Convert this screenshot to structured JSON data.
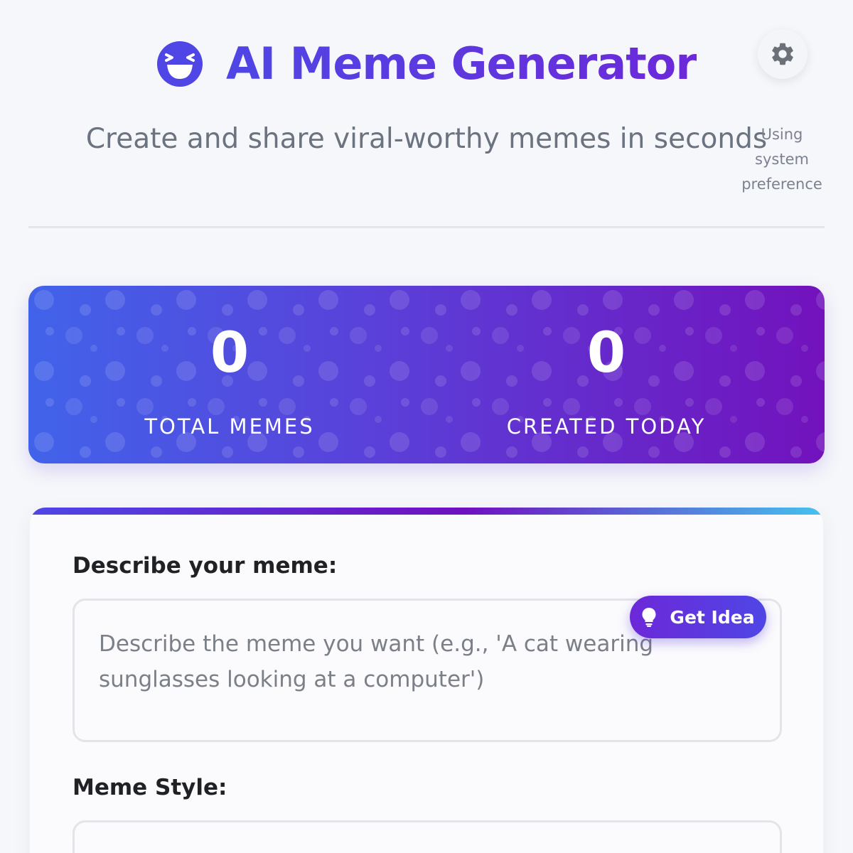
{
  "header": {
    "title": "AI Meme Generator",
    "subtitle": "Create and share viral-worthy memes in seconds",
    "logo_icon": "laughing-face-icon",
    "settings_icon": "gear-icon",
    "theme_note": "Using system preference"
  },
  "stats": {
    "total_memes": {
      "value": "0",
      "label": "TOTAL MEMES"
    },
    "created_today": {
      "value": "0",
      "label": "CREATED TODAY"
    }
  },
  "form": {
    "describe_label": "Describe your meme:",
    "describe_placeholder": "Describe the meme you want (e.g., 'A cat wearing sunglasses looking at a computer')",
    "get_idea_label": "Get Idea",
    "get_idea_icon": "lightbulb-icon",
    "style_label": "Meme Style:",
    "style_value": ""
  },
  "colors": {
    "accent": "#4f46e5",
    "accent_purple": "#6d28d9",
    "banner_start": "#4163ea",
    "banner_end": "#7212bd"
  }
}
